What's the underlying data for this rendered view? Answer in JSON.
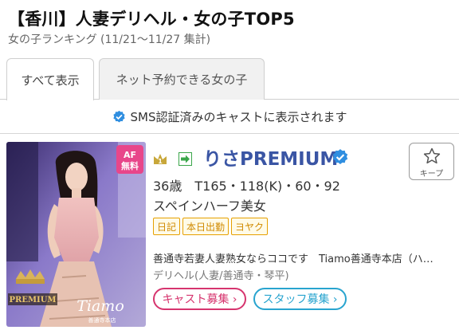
{
  "header": {
    "title": "【香川】人妻デリヘル・女の子TOP5",
    "subtitle": "女の子ランキング (11/21〜11/27 集計)"
  },
  "tabs": [
    {
      "label": "すべて表示",
      "active": true
    },
    {
      "label": "ネット予約できる女の子",
      "active": false
    }
  ],
  "sms_notice": {
    "text": "SMS認証済みのキャストに表示されます",
    "icon": "verified-check-icon"
  },
  "cast": {
    "rank": 1,
    "rank_icon": "crown-icon",
    "name": "りさPREMIUM",
    "verified": true,
    "stats": "36歳　T165・118(K)・60・92",
    "catchphrase": "スペインハーフ美女",
    "tags": [
      "日記",
      "本日出勤",
      "ヨヤク"
    ],
    "shop": "善通寺若妻人妻熟女ならココです　Tiamo善通寺本店（ハ…",
    "area": "デリヘル(人妻/善通寺・琴平)",
    "photo": {
      "badge_line1": "AF",
      "badge_line2": "無料",
      "premium_label": "PREMIUM",
      "brand": "Tiamo",
      "brand_sub": "善通寺本店"
    }
  },
  "keep_button": {
    "label": "キープ",
    "icon": "star-icon"
  },
  "recruit_buttons": {
    "cast": "キャスト募集 ›",
    "staff": "スタッフ募集 ›"
  },
  "colors": {
    "name": "#3a55a4",
    "verified": "#2f8ee0",
    "tag": "#e6a000",
    "cast_recruit": "#d6346e",
    "staff_recruit": "#28a4cf",
    "badge": "#e8468a"
  }
}
